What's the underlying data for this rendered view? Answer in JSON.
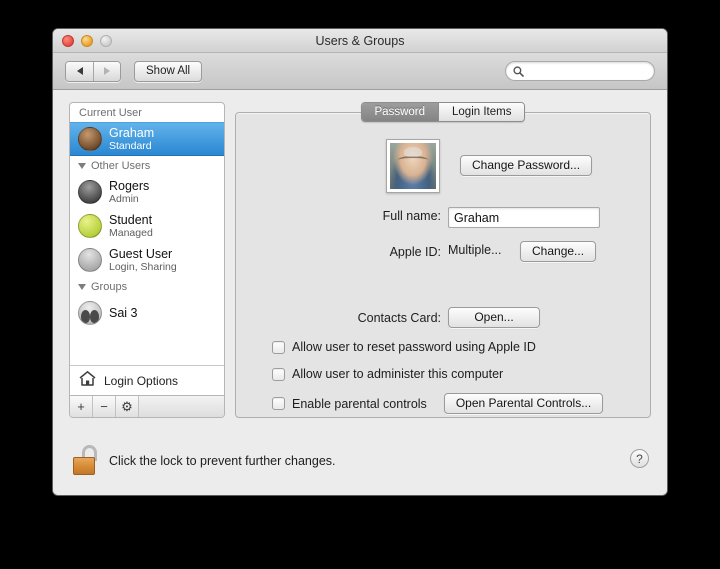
{
  "window": {
    "title": "Users & Groups"
  },
  "toolbar": {
    "back_icon": "left-arrow-icon",
    "forward_icon": "right-arrow-icon",
    "show_all_label": "Show All",
    "search_placeholder": "",
    "search_value": "",
    "search_icon": "search-icon"
  },
  "sidebar": {
    "sections": [
      {
        "header": "Current User",
        "collapsible": false,
        "users": [
          {
            "name": "Graham",
            "role": "Standard",
            "selected": true,
            "avatar": "photo-avatar"
          }
        ]
      },
      {
        "header": "Other Users",
        "collapsible": true,
        "users": [
          {
            "name": "Rogers",
            "role": "Admin",
            "selected": false,
            "avatar": "dark-avatar"
          },
          {
            "name": "Student",
            "role": "Managed",
            "selected": false,
            "avatar": "tennis-ball-avatar"
          },
          {
            "name": "Guest User",
            "role": "Login, Sharing",
            "selected": false,
            "avatar": "generic-person-avatar"
          }
        ]
      },
      {
        "header": "Groups",
        "collapsible": true,
        "users": [
          {
            "name": "Sai 3",
            "role": "",
            "selected": false,
            "avatar": "group-avatar"
          }
        ]
      }
    ],
    "login_options_label": "Login Options",
    "login_options_icon": "house-icon",
    "add_button": "+",
    "remove_button": "−",
    "settings_button": "⚙"
  },
  "tabs": [
    {
      "label": "Password",
      "active": true
    },
    {
      "label": "Login Items",
      "active": false
    }
  ],
  "main": {
    "change_password_label": "Change Password...",
    "full_name_label": "Full name:",
    "full_name_value": "Graham",
    "apple_id_label": "Apple ID:",
    "apple_id_value": "Multiple...",
    "apple_id_change_label": "Change...",
    "contacts_card_label": "Contacts Card:",
    "contacts_card_open_label": "Open...",
    "checkboxes": [
      {
        "label": "Allow user to reset password using Apple ID",
        "checked": false
      },
      {
        "label": "Allow user to administer this computer",
        "checked": false
      },
      {
        "label": "Enable parental controls",
        "checked": false
      }
    ],
    "parental_controls_button": "Open Parental Controls..."
  },
  "footer": {
    "lock_icon": "unlocked-padlock-icon",
    "lock_text": "Click the lock to prevent further changes.",
    "help_label": "?"
  },
  "colors": {
    "selection_blue": "#2a87d2",
    "lock_orange": "#d98f38",
    "window_bg": "#ececec",
    "panel_bg": "#e4e4e4"
  }
}
